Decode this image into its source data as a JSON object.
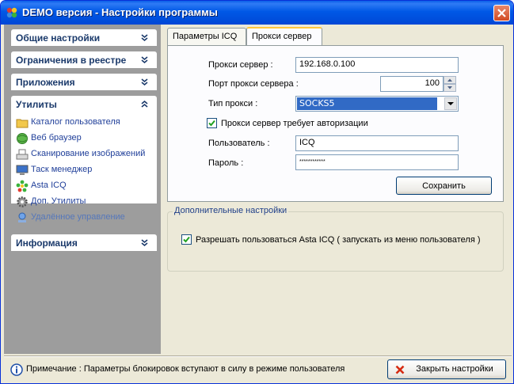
{
  "window": {
    "title": "DEMO версия - Настройки программы"
  },
  "sidebar": {
    "sections": {
      "general": "Общие настройки",
      "registry": "Ограничения в реестре",
      "apps": "Приложения",
      "utils": "Утилиты",
      "info": "Информация"
    },
    "utilities": [
      {
        "label": "Каталог пользователя",
        "icon": "folder-icon"
      },
      {
        "label": "Веб браузер",
        "icon": "globe-icon"
      },
      {
        "label": "Сканирование изображений",
        "icon": "scanner-icon"
      },
      {
        "label": "Таск менеджер",
        "icon": "monitor-icon"
      },
      {
        "label": "Asta ICQ",
        "icon": "icq-flower-icon"
      },
      {
        "label": "Доп. Утилиты",
        "icon": "gear-icon"
      },
      {
        "label": "Удалённое управление",
        "icon": "remote-icon"
      }
    ]
  },
  "tabs": [
    {
      "label": "Параметры ICQ",
      "active": false
    },
    {
      "label": "Прокси сервер",
      "active": true
    }
  ],
  "proxy": {
    "server_label": "Прокси сервер :",
    "server_value": "192.168.0.100",
    "port_label": "Порт прокси сервера :",
    "port_value": "100",
    "type_label": "Тип прокси :",
    "type_value": "SOCKS5",
    "auth_label": "Прокси сервер требует авторизации",
    "auth_checked": true,
    "user_label": "Пользователь :",
    "user_value": "ICQ",
    "password_label": "Пароль :",
    "password_value": "************",
    "save_label": "Сохранить"
  },
  "extra": {
    "title": "Дополнительные настройки",
    "allow_label": "Разрешать пользоваться Asta ICQ ( запускать из меню пользователя )",
    "allow_checked": true
  },
  "status": {
    "note": "Примечание : Параметры блокировок вступают в силу в режиме пользователя",
    "close_label": "Закрыть настройки"
  },
  "colors": {
    "titlebar": "#0058E6",
    "sidebar": "#9D9D9D",
    "selection": "#316AC5",
    "link": "#21409A"
  }
}
